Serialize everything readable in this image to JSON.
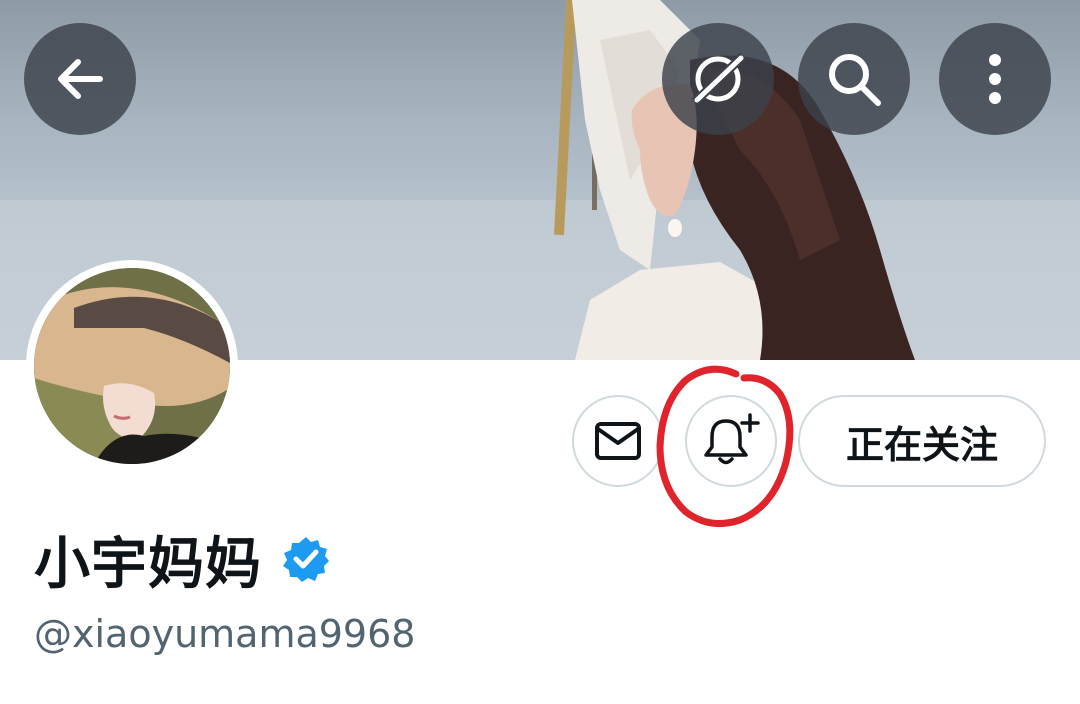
{
  "profile": {
    "display_name": "小宇妈妈",
    "handle": "@xiaoyumama9968",
    "verified": true
  },
  "header": {
    "back_icon": "arrow-left-icon",
    "grok_icon": "grok-icon",
    "search_icon": "search-icon",
    "more_icon": "more-vertical-icon"
  },
  "actions": {
    "message_icon": "mail-icon",
    "notify_icon": "bell-plus-icon",
    "follow_label": "正在关注"
  },
  "colors": {
    "verified_badge": "#1d9bf0",
    "annotation": "#e0242b",
    "primary_text": "#0f1419",
    "secondary_text": "#536471"
  }
}
